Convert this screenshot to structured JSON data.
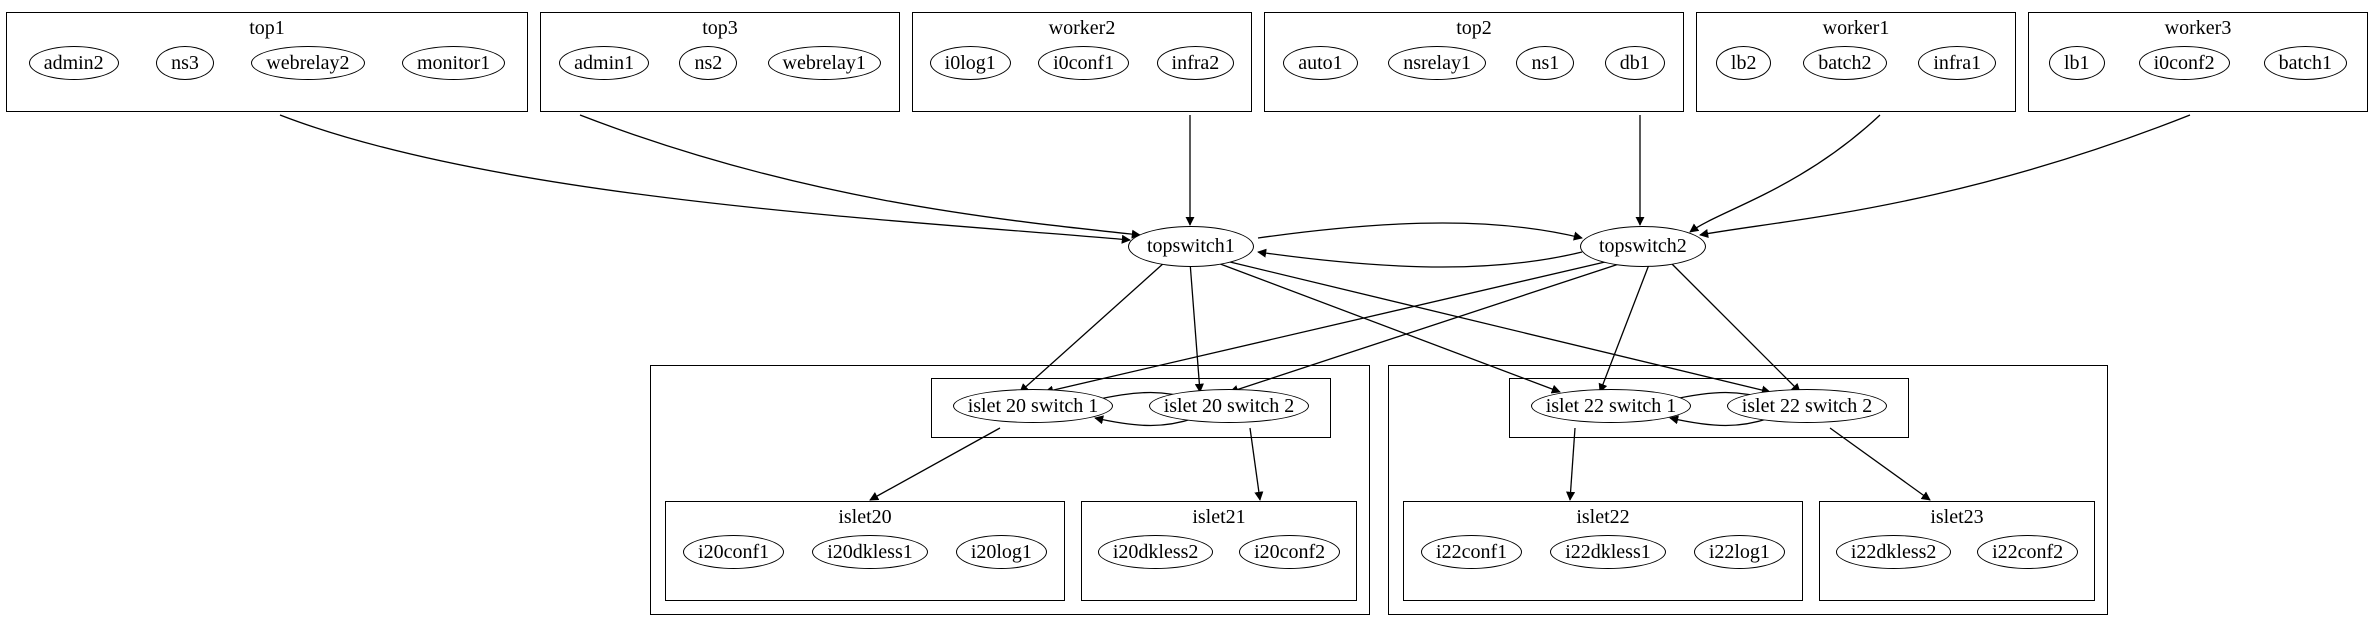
{
  "top_clusters": [
    {
      "title": "top1",
      "nodes": [
        "admin2",
        "ns3",
        "webrelay2",
        "monitor1"
      ]
    },
    {
      "title": "top3",
      "nodes": [
        "admin1",
        "ns2",
        "webrelay1"
      ]
    },
    {
      "title": "worker2",
      "nodes": [
        "i0log1",
        "i0conf1",
        "infra2"
      ]
    },
    {
      "title": "top2",
      "nodes": [
        "auto1",
        "nsrelay1",
        "ns1",
        "db1"
      ]
    },
    {
      "title": "worker1",
      "nodes": [
        "lb2",
        "batch2",
        "infra1"
      ]
    },
    {
      "title": "worker3",
      "nodes": [
        "lb1",
        "i0conf2",
        "batch1"
      ]
    }
  ],
  "switches": {
    "topswitch1": "topswitch1",
    "topswitch2": "topswitch2"
  },
  "islets": {
    "left": {
      "switch_box": {
        "nodes": [
          "islet 20 switch 1",
          "islet 20 switch 2"
        ]
      },
      "child_boxes": [
        {
          "title": "islet20",
          "nodes": [
            "i20conf1",
            "i20dkless1",
            "i20log1"
          ]
        },
        {
          "title": "islet21",
          "nodes": [
            "i20dkless2",
            "i20conf2"
          ]
        }
      ]
    },
    "right": {
      "switch_box": {
        "nodes": [
          "islet 22 switch 1",
          "islet 22 switch 2"
        ]
      },
      "child_boxes": [
        {
          "title": "islet22",
          "nodes": [
            "i22conf1",
            "i22dkless1",
            "i22log1"
          ]
        },
        {
          "title": "islet23",
          "nodes": [
            "i22dkless2",
            "i22conf2"
          ]
        }
      ]
    }
  },
  "chart_data": {
    "type": "graph",
    "directed": true,
    "clusters": [
      {
        "name": "top1",
        "nodes": [
          "admin2",
          "ns3",
          "webrelay2",
          "monitor1"
        ]
      },
      {
        "name": "top3",
        "nodes": [
          "admin1",
          "ns2",
          "webrelay1"
        ]
      },
      {
        "name": "worker2",
        "nodes": [
          "i0log1",
          "i0conf1",
          "infra2"
        ]
      },
      {
        "name": "top2",
        "nodes": [
          "auto1",
          "nsrelay1",
          "ns1",
          "db1"
        ]
      },
      {
        "name": "worker1",
        "nodes": [
          "lb2",
          "batch2",
          "infra1"
        ]
      },
      {
        "name": "worker3",
        "nodes": [
          "lb1",
          "i0conf2",
          "batch1"
        ]
      },
      {
        "name": "islet20_switches",
        "nodes": [
          "islet 20 switch 1",
          "islet 20 switch 2"
        ]
      },
      {
        "name": "islet20",
        "nodes": [
          "i20conf1",
          "i20dkless1",
          "i20log1"
        ]
      },
      {
        "name": "islet21",
        "nodes": [
          "i20dkless2",
          "i20conf2"
        ]
      },
      {
        "name": "islet22_switches",
        "nodes": [
          "islet 22 switch 1",
          "islet 22 switch 2"
        ]
      },
      {
        "name": "islet22",
        "nodes": [
          "i22conf1",
          "i22dkless1",
          "i22log1"
        ]
      },
      {
        "name": "islet23",
        "nodes": [
          "i22dkless2",
          "i22conf2"
        ]
      }
    ],
    "free_nodes": [
      "topswitch1",
      "topswitch2"
    ],
    "edges": [
      [
        "top1",
        "topswitch1"
      ],
      [
        "top3",
        "topswitch1"
      ],
      [
        "worker2",
        "topswitch1"
      ],
      [
        "top2",
        "topswitch2"
      ],
      [
        "worker1",
        "topswitch2"
      ],
      [
        "worker3",
        "topswitch2"
      ],
      [
        "topswitch1",
        "topswitch2"
      ],
      [
        "topswitch2",
        "topswitch1"
      ],
      [
        "topswitch1",
        "islet 20 switch 1"
      ],
      [
        "topswitch1",
        "islet 20 switch 2"
      ],
      [
        "topswitch1",
        "islet 22 switch 1"
      ],
      [
        "topswitch1",
        "islet 22 switch 2"
      ],
      [
        "topswitch2",
        "islet 20 switch 1"
      ],
      [
        "topswitch2",
        "islet 20 switch 2"
      ],
      [
        "topswitch2",
        "islet 22 switch 1"
      ],
      [
        "topswitch2",
        "islet 22 switch 2"
      ],
      [
        "islet 20 switch 1",
        "islet 20 switch 2"
      ],
      [
        "islet 20 switch 2",
        "islet 20 switch 1"
      ],
      [
        "islet 20 switch 1",
        "islet20"
      ],
      [
        "islet 20 switch 2",
        "islet21"
      ],
      [
        "islet 22 switch 1",
        "islet 22 switch 2"
      ],
      [
        "islet 22 switch 2",
        "islet 22 switch 1"
      ],
      [
        "islet 22 switch 1",
        "islet22"
      ],
      [
        "islet 22 switch 2",
        "islet23"
      ]
    ]
  }
}
